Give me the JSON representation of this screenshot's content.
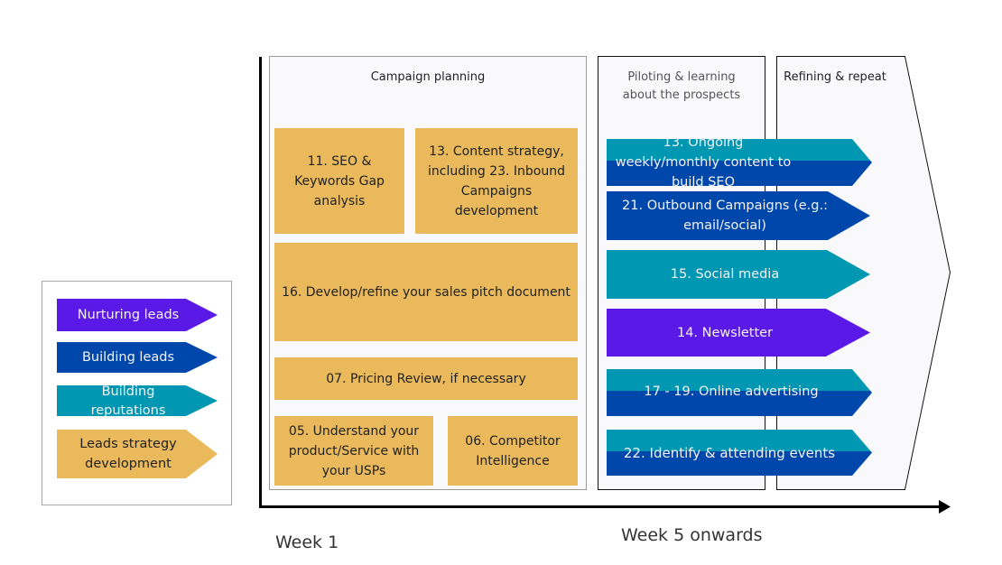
{
  "colors": {
    "nurturing": "#5b19e8",
    "building_leads": "#0047ab",
    "building_reputations": "#0097b2",
    "strategy": "#e9b95c",
    "panel_bg": "#f9f9fb",
    "axis": "#000000"
  },
  "legend": {
    "items": [
      {
        "label": "Nurturing leads",
        "category": "nurturing"
      },
      {
        "label": "Building leads",
        "category": "building_leads"
      },
      {
        "label": "Building reputations",
        "category": "building_reputations"
      },
      {
        "label": "Leads strategy development",
        "category": "strategy"
      }
    ]
  },
  "phases": {
    "campaign_planning": {
      "title": "Campaign planning",
      "cards": [
        {
          "label": "11. SEO & Keywords Gap analysis"
        },
        {
          "label": "13. Content strategy, including 23. Inbound Campaigns development"
        },
        {
          "label": "16. Develop/refine your sales pitch document"
        },
        {
          "label": "07. Pricing Review, if necessary"
        },
        {
          "label": "05. Understand your product/Service with your USPs"
        },
        {
          "label": "06. Competitor Intelligence"
        }
      ]
    },
    "piloting": {
      "title": "Piloting & learning about the prospects"
    },
    "refining": {
      "title": "Refining & repeat"
    }
  },
  "activities": [
    {
      "label": "13. Ongoing weekly/monthly content to build SEO",
      "categories": [
        "building_reputations",
        "building_leads"
      ]
    },
    {
      "label": "21. Outbound Campaigns (e.g.: email/social)",
      "categories": [
        "building_leads"
      ]
    },
    {
      "label": "15. Social media",
      "categories": [
        "building_reputations"
      ]
    },
    {
      "label": "14. Newsletter",
      "categories": [
        "nurturing"
      ]
    },
    {
      "label": "17 - 19. Online advertising",
      "categories": [
        "building_reputations",
        "building_leads"
      ]
    },
    {
      "label": "22. Identify & attending events",
      "categories": [
        "building_reputations",
        "building_leads"
      ]
    }
  ],
  "axis": {
    "start_label": "Week 1",
    "end_label": "Week 5 onwards"
  }
}
